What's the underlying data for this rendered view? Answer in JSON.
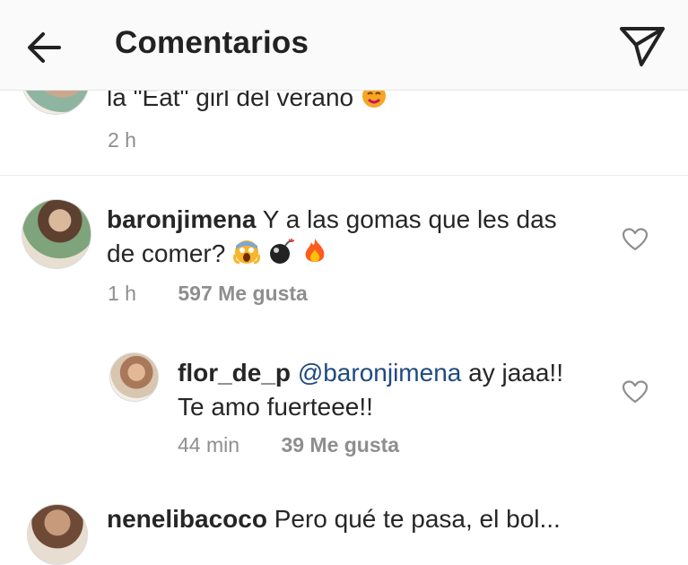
{
  "header": {
    "back_icon": "arrow-left-icon",
    "title": "Comentarios",
    "send_icon": "paper-plane-icon"
  },
  "comments": [
    {
      "text": "la \"Eat\" girl del verano",
      "emoji": [
        "face-emoji"
      ],
      "time": "2 h"
    },
    {
      "username": "baronjimena",
      "text_line1": "Y a las gomas que les das",
      "text_line2": "de comer?",
      "emoji": [
        "screaming-face-emoji",
        "bomb-emoji",
        "fire-emoji"
      ],
      "time": "1 h",
      "likes": "597 Me gusta"
    },
    {
      "username": "flor_de_p",
      "mention": "@baronjimena",
      "text_line1": "ay jaaa!!",
      "text_line2": "Te amo fuerteee!!",
      "time": "44 min",
      "likes": "39 Me gusta"
    },
    {
      "username": "nenelibacoco",
      "text": "Pero qué te pasa, el bol..."
    }
  ],
  "colors": {
    "header_bg": "#fafafa",
    "text": "#262626",
    "meta": "#8e8e8e",
    "mention": "#1f4a7f"
  }
}
